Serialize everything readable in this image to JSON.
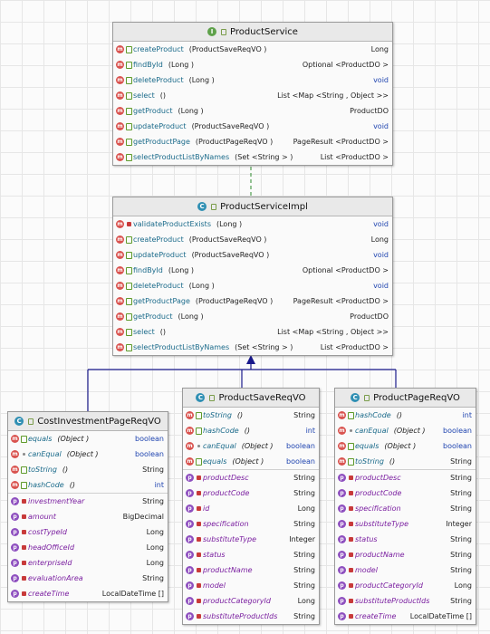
{
  "product_service": {
    "name": "ProductService",
    "methods": [
      {
        "name": "createProduct",
        "params": "(ProductSaveReqVO )",
        "ret": "Long"
      },
      {
        "name": "findById",
        "params": "(Long )",
        "ret": "Optional <ProductDO >"
      },
      {
        "name": "deleteProduct",
        "params": "(Long )",
        "ret": "void"
      },
      {
        "name": "select",
        "params": "()",
        "ret": "List <Map <String , Object >>"
      },
      {
        "name": "getProduct",
        "params": "(Long )",
        "ret": "ProductDO"
      },
      {
        "name": "updateProduct",
        "params": "(ProductSaveReqVO )",
        "ret": "void"
      },
      {
        "name": "getProductPage",
        "params": "(ProductPageReqVO )",
        "ret": "PageResult <ProductDO >"
      },
      {
        "name": "selectProductListByNames",
        "params": "(Set <String > )",
        "ret": "List <ProductDO >"
      }
    ]
  },
  "product_service_impl": {
    "name": "ProductServiceImpl",
    "methods": [
      {
        "name": "validateProductExists",
        "params": "(Long )",
        "ret": "void"
      },
      {
        "name": "createProduct",
        "params": "(ProductSaveReqVO )",
        "ret": "Long"
      },
      {
        "name": "updateProduct",
        "params": "(ProductSaveReqVO )",
        "ret": "void"
      },
      {
        "name": "findById",
        "params": "(Long )",
        "ret": "Optional <ProductDO >"
      },
      {
        "name": "deleteProduct",
        "params": "(Long )",
        "ret": "void"
      },
      {
        "name": "getProductPage",
        "params": "(ProductPageReqVO )",
        "ret": "PageResult <ProductDO >"
      },
      {
        "name": "getProduct",
        "params": "(Long )",
        "ret": "ProductDO"
      },
      {
        "name": "select",
        "params": "()",
        "ret": "List <Map <String , Object >>"
      },
      {
        "name": "selectProductListByNames",
        "params": "(Set <String > )",
        "ret": "List <ProductDO >"
      }
    ]
  },
  "cost_investment": {
    "name": "CostInvestmentPageReqVO",
    "methods": [
      {
        "name": "equals",
        "params": "(Object )",
        "ret": "boolean"
      },
      {
        "name": "canEqual",
        "params": "(Object )",
        "ret": "boolean"
      },
      {
        "name": "toString",
        "params": "()",
        "ret": "String"
      },
      {
        "name": "hashCode",
        "params": "()",
        "ret": "int"
      }
    ],
    "fields": [
      {
        "name": "investmentYear",
        "type": "String"
      },
      {
        "name": "amount",
        "type": "BigDecimal"
      },
      {
        "name": "costTypeId",
        "type": "Long"
      },
      {
        "name": "headOfficeId",
        "type": "Long"
      },
      {
        "name": "enterpriseId",
        "type": "Long"
      },
      {
        "name": "evaluationArea",
        "type": "String"
      },
      {
        "name": "createTime",
        "type": "LocalDateTime []"
      }
    ]
  },
  "product_save": {
    "name": "ProductSaveReqVO",
    "methods": [
      {
        "name": "toString",
        "params": "()",
        "ret": "String"
      },
      {
        "name": "hashCode",
        "params": "()",
        "ret": "int"
      },
      {
        "name": "canEqual",
        "params": "(Object )",
        "ret": "boolean"
      },
      {
        "name": "equals",
        "params": "(Object )",
        "ret": "boolean"
      }
    ],
    "fields": [
      {
        "name": "productDesc",
        "type": "String"
      },
      {
        "name": "productCode",
        "type": "String"
      },
      {
        "name": "id",
        "type": "Long"
      },
      {
        "name": "specification",
        "type": "String"
      },
      {
        "name": "substituteType",
        "type": "Integer"
      },
      {
        "name": "status",
        "type": "String"
      },
      {
        "name": "productName",
        "type": "String"
      },
      {
        "name": "model",
        "type": "String"
      },
      {
        "name": "productCategoryId",
        "type": "Long"
      },
      {
        "name": "substituteProductIds",
        "type": "String"
      }
    ]
  },
  "product_page": {
    "name": "ProductPageReqVO",
    "methods": [
      {
        "name": "hashCode",
        "params": "()",
        "ret": "int"
      },
      {
        "name": "canEqual",
        "params": "(Object )",
        "ret": "boolean"
      },
      {
        "name": "equals",
        "params": "(Object )",
        "ret": "boolean"
      },
      {
        "name": "toString",
        "params": "()",
        "ret": "String"
      }
    ],
    "fields": [
      {
        "name": "productDesc",
        "type": "String"
      },
      {
        "name": "productCode",
        "type": "String"
      },
      {
        "name": "specification",
        "type": "String"
      },
      {
        "name": "substituteType",
        "type": "Integer"
      },
      {
        "name": "status",
        "type": "String"
      },
      {
        "name": "productName",
        "type": "String"
      },
      {
        "name": "model",
        "type": "String"
      },
      {
        "name": "productCategoryId",
        "type": "Long"
      },
      {
        "name": "substituteProductIds",
        "type": "String"
      },
      {
        "name": "createTime",
        "type": "LocalDateTime []"
      }
    ]
  }
}
